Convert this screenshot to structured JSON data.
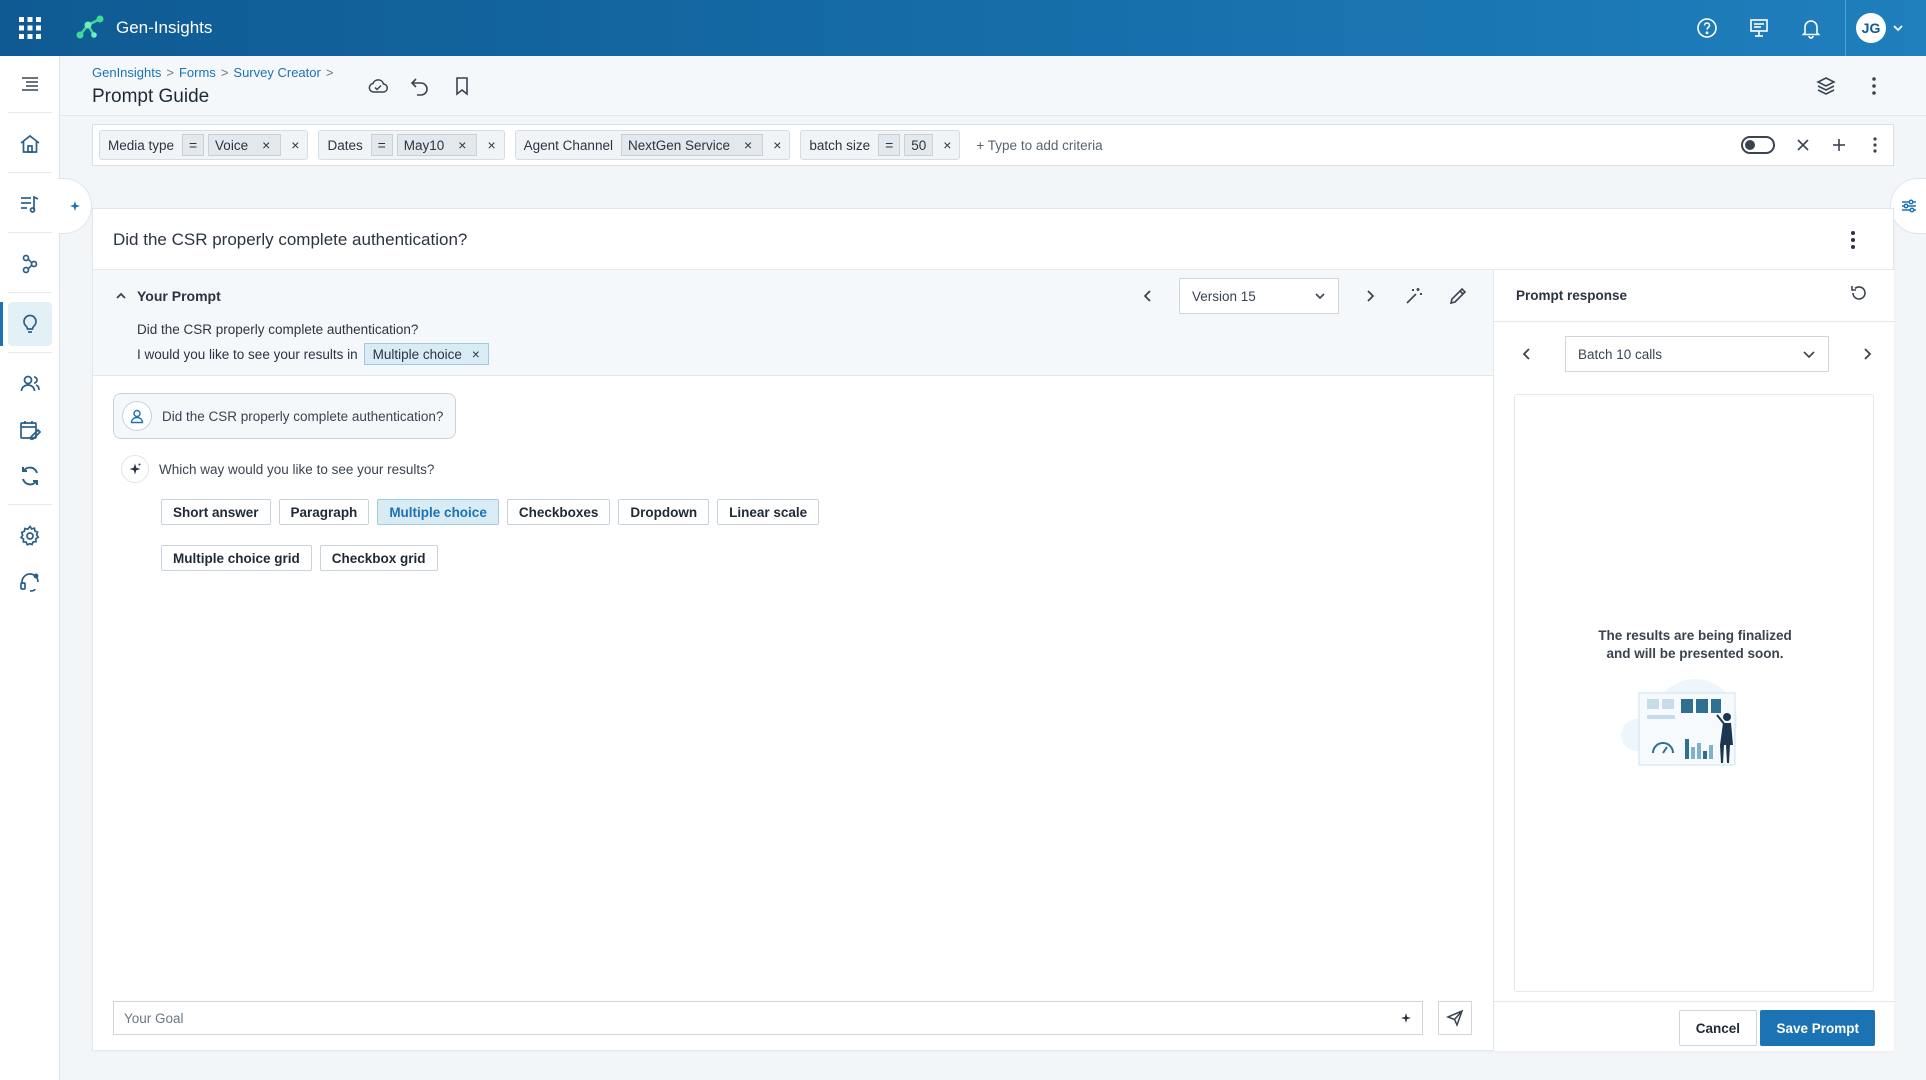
{
  "app": {
    "name": "Gen-Insights",
    "user_initials": "JG"
  },
  "breadcrumb": [
    "GenInsights",
    "Forms",
    "Survey Creator"
  ],
  "page_title": "Prompt Guide",
  "filters": {
    "chips": [
      {
        "label": "Media type",
        "op": "=",
        "value": "Voice"
      },
      {
        "label": "Dates",
        "op": "=",
        "value": "May10"
      },
      {
        "label": "Agent Channel",
        "op": "",
        "value": "NextGen Service"
      },
      {
        "label": "batch size",
        "op": "=",
        "value": "50"
      }
    ],
    "add_placeholder": "+ Type to add criteria"
  },
  "question": {
    "title": "Did the CSR properly complete authentication?"
  },
  "your_prompt": {
    "title": "Your Prompt",
    "line1": "Did the CSR properly complete authentication?",
    "line2_prefix": "I  would you like to see your results in",
    "tag": "Multiple choice",
    "version": "Version 15"
  },
  "chat": {
    "user_message": "Did the CSR properly complete authentication?",
    "ai_message": "Which way would you like to see your results?",
    "options_row1": [
      "Short answer",
      "Paragraph",
      "Multiple choice",
      "Checkboxes",
      "Dropdown",
      "Linear scale"
    ],
    "options_row2": [
      "Multiple choice grid",
      "Checkbox grid"
    ],
    "selected_option": "Multiple choice"
  },
  "goal": {
    "placeholder": "Your Goal",
    "value": ""
  },
  "response": {
    "title": "Prompt response",
    "batch": "Batch 10 calls",
    "message_line1": "The results are being finalized",
    "message_line2": "and will be presented soon.",
    "cancel_label": "Cancel",
    "save_label": "Save Prompt"
  },
  "colors": {
    "topbar": "#0f5a93",
    "accent": "#1b73b3",
    "selected_bg": "#d9ecf5",
    "logo_green": "#3ddc97"
  }
}
